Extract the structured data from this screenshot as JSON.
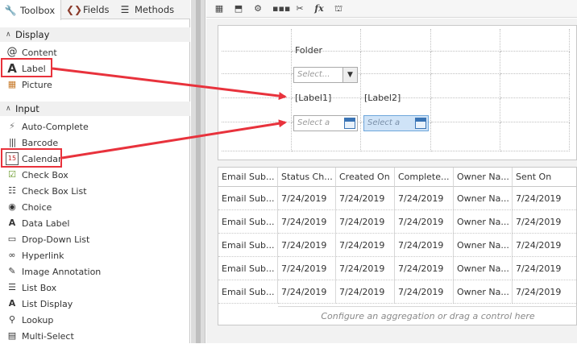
{
  "tabs": [
    {
      "label": "Toolbox",
      "icon": "wrench-icon"
    },
    {
      "label": "Fields",
      "icon": "fields-icon"
    },
    {
      "label": "Methods",
      "icon": "methods-icon"
    }
  ],
  "sections": {
    "display": "Display",
    "input": "Input"
  },
  "display_items": [
    "Content",
    "Label",
    "Picture"
  ],
  "input_items": [
    "Auto-Complete",
    "Barcode",
    "Calendar",
    "Check Box",
    "Check Box List",
    "Choice",
    "Data Label",
    "Drop-Down List",
    "Hyperlink",
    "Image Annotation",
    "List Box",
    "List Display",
    "Lookup",
    "Multi-Select"
  ],
  "toolbar_icons": [
    "table-icon",
    "image-up-icon",
    "gear-icon",
    "dots-icon",
    "tools-icon",
    "fx-icon",
    "hat-icon"
  ],
  "toolbar_fx": "fx",
  "form": {
    "folder_label": "Folder",
    "dropdown_placeholder": "Select...",
    "label1": "[Label1]",
    "label2": "[Label2]",
    "calendar1_placeholder": "Select a",
    "calendar2_placeholder": "Select a"
  },
  "list": {
    "headers": [
      "Email Sub...",
      "Status Ch...",
      "Created On",
      "Complete...",
      "Owner Na...",
      "Sent On"
    ],
    "rows": [
      [
        "Email Sub...",
        "7/24/2019",
        "7/24/2019",
        "7/24/2019",
        "Owner Na...",
        "7/24/2019"
      ],
      [
        "Email Sub...",
        "7/24/2019",
        "7/24/2019",
        "7/24/2019",
        "Owner Na...",
        "7/24/2019"
      ],
      [
        "Email Sub...",
        "7/24/2019",
        "7/24/2019",
        "7/24/2019",
        "Owner Na...",
        "7/24/2019"
      ],
      [
        "Email Sub...",
        "7/24/2019",
        "7/24/2019",
        "7/24/2019",
        "Owner Na...",
        "7/24/2019"
      ],
      [
        "Email Sub...",
        "7/24/2019",
        "7/24/2019",
        "7/24/2019",
        "Owner Na...",
        "7/24/2019"
      ]
    ],
    "footer": "Configure an aggregation or drag a control here"
  },
  "colors": {
    "highlight": "#e8323c",
    "accent": "#3a74b5"
  }
}
